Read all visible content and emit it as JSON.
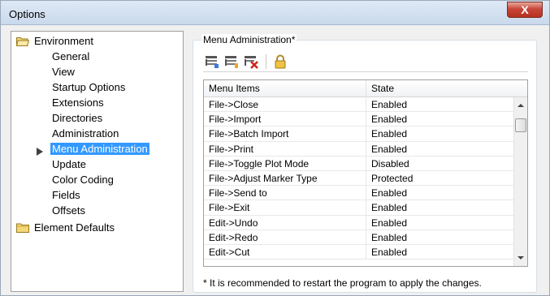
{
  "window": {
    "title": "Options",
    "close_glyph": "X"
  },
  "tree": {
    "root": {
      "label": "Environment",
      "icon": "open-folder-icon"
    },
    "children": [
      {
        "label": "General"
      },
      {
        "label": "View"
      },
      {
        "label": "Startup Options"
      },
      {
        "label": "Extensions"
      },
      {
        "label": "Directories"
      },
      {
        "label": "Administration"
      },
      {
        "label": "Menu Administration",
        "selected": true
      },
      {
        "label": "Update"
      },
      {
        "label": "Color Coding"
      },
      {
        "label": "Fields"
      },
      {
        "label": "Offsets"
      }
    ],
    "second_root": {
      "label": "Element Defaults",
      "icon": "closed-folder-icon"
    }
  },
  "panel": {
    "group_title": "Menu Administration*",
    "toolbar_icons": [
      "menu-properties-icon",
      "menu-add-icon",
      "menu-remove-icon",
      "lock-icon"
    ],
    "columns": [
      "Menu Items",
      "State"
    ],
    "rows": [
      {
        "item": "File->Close",
        "state": "Enabled"
      },
      {
        "item": "File->Import",
        "state": "Enabled"
      },
      {
        "item": "File->Batch Import",
        "state": "Enabled"
      },
      {
        "item": "File->Print",
        "state": "Enabled"
      },
      {
        "item": "File->Toggle Plot Mode",
        "state": "Disabled"
      },
      {
        "item": "File->Adjust Marker Type",
        "state": "Protected"
      },
      {
        "item": "File->Send to",
        "state": "Enabled"
      },
      {
        "item": "File->Exit",
        "state": "Enabled"
      },
      {
        "item": "Edit->Undo",
        "state": "Enabled"
      },
      {
        "item": "Edit->Redo",
        "state": "Enabled"
      },
      {
        "item": "Edit->Cut",
        "state": "Enabled"
      }
    ],
    "note": "* It is recommended to restart the program to apply the changes."
  },
  "colors": {
    "selection": "#3399ff",
    "close_button": "#c7473a",
    "window_bg": "#f0f0f0"
  }
}
